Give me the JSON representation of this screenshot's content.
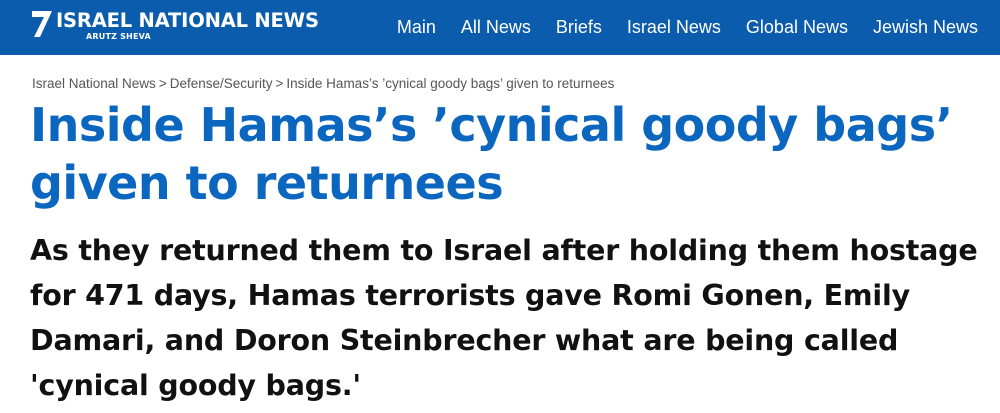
{
  "header": {
    "logo_title": "ISRAEL NATIONAL NEWS",
    "logo_subtitle": "ARUTZ SHEVA",
    "logo_icon": "seven-icon",
    "nav": [
      {
        "label": "Main"
      },
      {
        "label": "All News"
      },
      {
        "label": "Briefs"
      },
      {
        "label": "Israel News"
      },
      {
        "label": "Global News"
      },
      {
        "label": "Jewish News"
      }
    ],
    "background_color": "#0b5cad"
  },
  "breadcrumb": {
    "items": [
      {
        "label": "Israel National News"
      },
      {
        "label": "Defense/Security"
      },
      {
        "label": "Inside Hamas’s ’cynical goody bags’ given to returnees"
      }
    ],
    "separator": ">"
  },
  "article": {
    "title": "Inside Hamas’s ’cynical goody bags’ given to returnees",
    "subtitle": "As they returned them to Israel after holding them hostage for 471 days, Hamas terrorists gave Romi Gonen, Emily Damari, and Doron Steinbrecher what are being called 'cynical goody bags.'",
    "title_color": "#0b66c0"
  }
}
